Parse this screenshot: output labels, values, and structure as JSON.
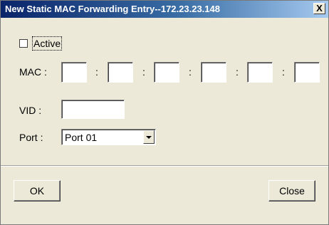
{
  "window": {
    "title": "New Static MAC Forwarding Entry--172.23.23.148",
    "close_glyph": "X"
  },
  "form": {
    "active": {
      "label": "Active",
      "checked": false
    },
    "mac": {
      "label": "MAC :",
      "separator": ":",
      "octets": [
        "",
        "",
        "",
        "",
        "",
        ""
      ]
    },
    "vid": {
      "label": "VID :",
      "value": ""
    },
    "port": {
      "label": "Port :",
      "selected": "Port 01"
    }
  },
  "buttons": {
    "ok_label": "OK",
    "close_label": "Close"
  },
  "icons": {
    "close": "close-icon",
    "dropdown": "chevron-down-icon"
  }
}
